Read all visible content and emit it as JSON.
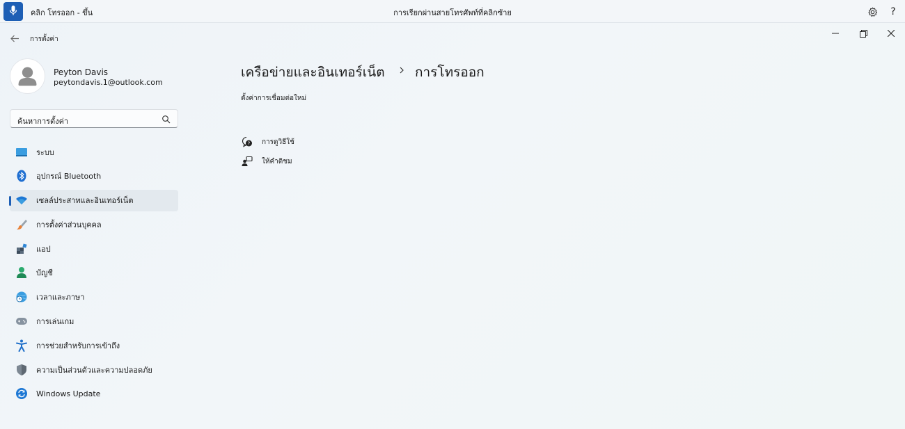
{
  "voice_bar": {
    "status": "คลิก โทรออก - ขึ้น",
    "hint": "การเรียกผ่านสายโทรศัพท์ที่คลิกซ้าย"
  },
  "window": {
    "app_title": "การตั้งค่า"
  },
  "profile": {
    "name": "Peyton Davis",
    "email": "peytondavis.1@outlook.com"
  },
  "search": {
    "text": "ค้นหาการตั้งค่า"
  },
  "nav": {
    "items": [
      {
        "label": "ระบบ",
        "icon": "system-icon"
      },
      {
        "label": "อุปกรณ์ Bluetooth",
        "icon": "bluetooth-icon"
      },
      {
        "label": "เซลล์ประสาทและอินเทอร์เน็ต",
        "icon": "wifi-icon",
        "active": true
      },
      {
        "label": "การตั้งค่าส่วนบุคคล",
        "icon": "paintbrush-icon"
      },
      {
        "label": "แอป",
        "icon": "apps-icon"
      },
      {
        "label": "บัญชี",
        "icon": "account-icon"
      },
      {
        "label": "เวลาและภาษา",
        "icon": "globe-clock-icon"
      },
      {
        "label": "การเล่นเกม",
        "icon": "gamepad-icon"
      },
      {
        "label": "การช่วยสำหรับการเข้าถึง",
        "icon": "accessibility-icon"
      },
      {
        "label": "ความเป็นส่วนตัวและความปลอดภัย",
        "icon": "shield-icon"
      },
      {
        "label": "Windows Update",
        "icon": "update-icon"
      }
    ]
  },
  "main": {
    "breadcrumb_parent": "เครือข่ายและอินเทอร์เน็ต",
    "breadcrumb_current": "การโทรออก",
    "subtitle": "ตั้งค่าการเชื่อมต่อใหม่",
    "help_link": "การดูวิธีใช้",
    "feedback_link": "ให้คำติชม"
  },
  "colors": {
    "accent": "#1e5fb5",
    "active_bg": "#e3e9ee"
  }
}
